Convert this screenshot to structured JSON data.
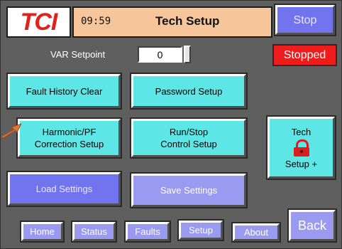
{
  "header": {
    "logo_text": "TCI",
    "time": "09:59",
    "title": "Tech Setup",
    "stop_label": "Stop"
  },
  "status": {
    "state": "Stopped",
    "state_color": "#ee1c1c"
  },
  "var_setpoint": {
    "label": "VAR Setpoint",
    "value": "0"
  },
  "buttons": {
    "fault_history_clear": "Fault History Clear",
    "password_setup": "Password Setup",
    "harmonic_line1": "Harmonic/PF",
    "harmonic_line2": "Correction Setup",
    "run_stop_line1": "Run/Stop",
    "run_stop_line2": "Control Setup",
    "tech_setup_line1": "Tech",
    "tech_setup_line2": "Setup +",
    "load_settings": "Load Settings",
    "save_settings": "Save Settings"
  },
  "nav": {
    "home": "Home",
    "status": "Status",
    "faults": "Faults",
    "setup": "Setup",
    "about": "About",
    "back": "Back"
  },
  "icons": {
    "tech_setup_icon": "lock-icon",
    "pointer": "arrow-icon"
  },
  "colors": {
    "accent_cyan": "#5de6e6",
    "accent_blue": "#7273ee",
    "header_bg": "#f7c59a",
    "logo_red": "#e0211c"
  }
}
